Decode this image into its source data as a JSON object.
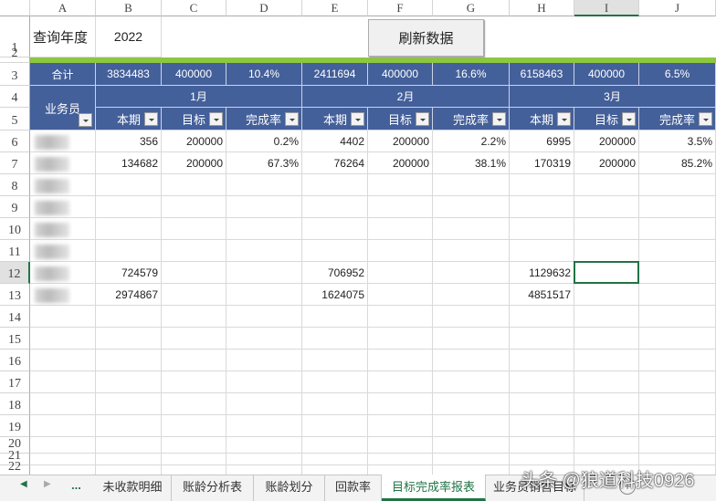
{
  "columns": [
    "A",
    "B",
    "C",
    "D",
    "E",
    "F",
    "G",
    "H",
    "I",
    "J"
  ],
  "rows": [
    "1",
    "2",
    "3",
    "4",
    "5",
    "6",
    "7",
    "8",
    "9",
    "10",
    "11",
    "12",
    "13",
    "14",
    "15",
    "16",
    "17",
    "18",
    "19",
    "20",
    "21",
    "22"
  ],
  "query": {
    "label": "查询年度",
    "year": "2022",
    "refresh_button": "刷新数据"
  },
  "totals": {
    "label": "合计",
    "values": [
      "3834483",
      "400000",
      "10.4%",
      "2411694",
      "400000",
      "16.6%",
      "6158463",
      "400000",
      "6.5%"
    ]
  },
  "salesperson_header": "业务员",
  "months": [
    "1月",
    "2月",
    "3月"
  ],
  "subheaders": [
    "本期",
    "目标",
    "完成率"
  ],
  "data_rows": [
    [
      "356",
      "200000",
      "0.2%",
      "4402",
      "200000",
      "2.2%",
      "6995",
      "200000",
      "3.5%"
    ],
    [
      "134682",
      "200000",
      "67.3%",
      "76264",
      "200000",
      "38.1%",
      "170319",
      "200000",
      "85.2%"
    ],
    [
      "",
      "",
      "",
      "",
      "",
      "",
      "",
      "",
      ""
    ],
    [
      "",
      "",
      "",
      "",
      "",
      "",
      "",
      "",
      ""
    ],
    [
      "",
      "",
      "",
      "",
      "",
      "",
      "",
      "",
      ""
    ],
    [
      "",
      "",
      "",
      "",
      "",
      "",
      "",
      "",
      ""
    ],
    [
      "724579",
      "",
      "",
      "706952",
      "",
      "",
      "1129632",
      "",
      ""
    ],
    [
      "2974867",
      "",
      "",
      "1624075",
      "",
      "",
      "4851517",
      "",
      ""
    ]
  ],
  "sheet_tabs": [
    "未收款明细",
    "账龄分析表",
    "账龄划分",
    "回款率",
    "目标完成率报表",
    "业务员销售目标"
  ],
  "active_tab": "目标完成率报表",
  "more_tabs": "...",
  "watermark": "头条 @狼道科技0926",
  "colors": {
    "header_blue": "#44609a",
    "accent_green": "#8dc63f",
    "excel_green": "#217346"
  }
}
